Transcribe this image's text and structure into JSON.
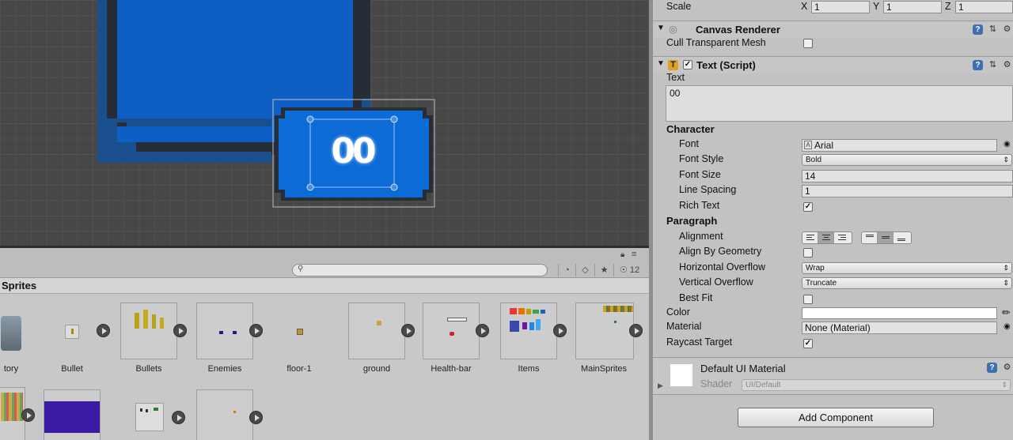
{
  "scene": {
    "text_value": "00"
  },
  "project": {
    "breadcrumb": "Sprites",
    "hidden_count": "12",
    "search_placeholder": "",
    "assets_row1": [
      {
        "label": "tory"
      },
      {
        "label": "Bullet"
      },
      {
        "label": "Bullets"
      },
      {
        "label": "Enemies"
      },
      {
        "label": "floor-1"
      },
      {
        "label": "ground"
      },
      {
        "label": "Health-bar"
      },
      {
        "label": "Items"
      },
      {
        "label": "MainSprites"
      }
    ]
  },
  "inspector": {
    "scale": {
      "label": "Scale",
      "x_label": "X",
      "x": "1",
      "y_label": "Y",
      "y": "1",
      "z_label": "Z",
      "z": "1"
    },
    "canvas_renderer": {
      "title": "Canvas Renderer",
      "cull_label": "Cull Transparent Mesh",
      "cull_checked": false
    },
    "text_script": {
      "title": "Text (Script)",
      "text_label": "Text",
      "text_value": "00",
      "character_label": "Character",
      "font_label": "Font",
      "font_value": "Arial",
      "font_style_label": "Font Style",
      "font_style_value": "Bold",
      "font_size_label": "Font Size",
      "font_size_value": "14",
      "line_spacing_label": "Line Spacing",
      "line_spacing_value": "1",
      "rich_text_label": "Rich Text",
      "rich_text_checked": true,
      "paragraph_label": "Paragraph",
      "alignment_label": "Alignment",
      "align_by_geometry_label": "Align By Geometry",
      "align_by_geometry_checked": false,
      "h_overflow_label": "Horizontal Overflow",
      "h_overflow_value": "Wrap",
      "v_overflow_label": "Vertical Overflow",
      "v_overflow_value": "Truncate",
      "best_fit_label": "Best Fit",
      "best_fit_checked": false,
      "color_label": "Color",
      "color_value": "#ffffff",
      "material_label": "Material",
      "material_value": "None (Material)",
      "raycast_label": "Raycast Target",
      "raycast_checked": true
    },
    "material_block": {
      "title": "Default UI Material",
      "shader_label": "Shader",
      "shader_value": "UI/Default"
    },
    "add_component_label": "Add Component"
  },
  "colors": {
    "accent_blue": "#1565c0",
    "help_blue": "#3e6fb0"
  }
}
